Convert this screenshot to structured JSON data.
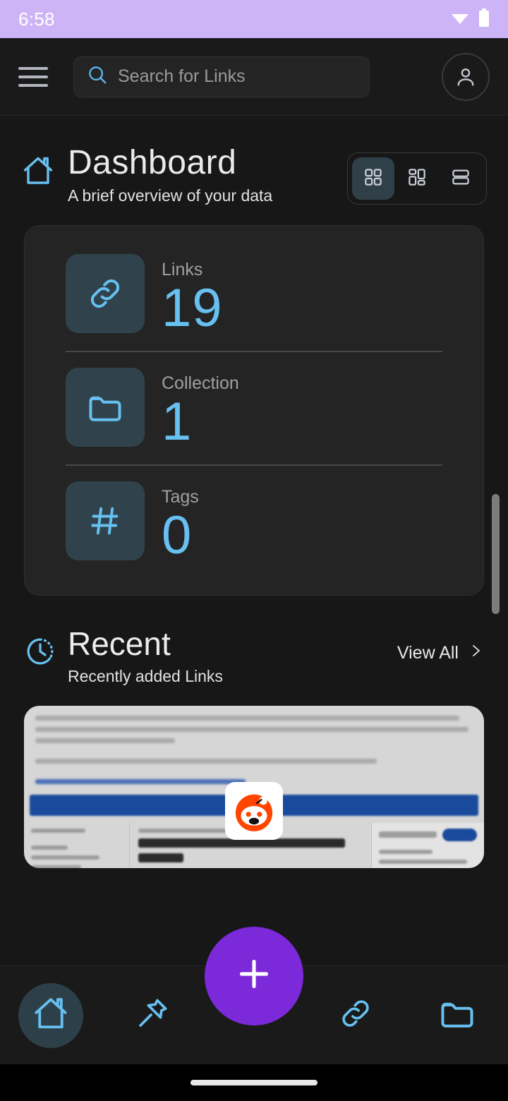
{
  "status_bar": {
    "time": "6:58",
    "icons": [
      "wifi-icon",
      "battery-icon"
    ],
    "background": "#cdb4f7"
  },
  "app_bar": {
    "menu_icon": "hamburger-menu-icon",
    "search": {
      "icon": "search-icon",
      "placeholder": "Search for Links",
      "value": ""
    },
    "profile_icon": "user-avatar-icon"
  },
  "page": {
    "icon": "home-icon",
    "title": "Dashboard",
    "subtitle": "A brief overview of your data",
    "view_modes": [
      {
        "name": "grid-view",
        "icon": "grid-icon",
        "active": true
      },
      {
        "name": "masonry-view",
        "icon": "masonry-icon",
        "active": false
      },
      {
        "name": "list-view",
        "icon": "list-icon",
        "active": false
      }
    ]
  },
  "stats": [
    {
      "icon": "link-icon",
      "label": "Links",
      "value": "19"
    },
    {
      "icon": "folder-icon",
      "label": "Collection",
      "value": "1"
    },
    {
      "icon": "hash-tag-icon",
      "label": "Tags",
      "value": "0"
    }
  ],
  "recent": {
    "icon": "clock-history-icon",
    "title": "Recent",
    "subtitle": "Recently added Links",
    "view_all_label": "View All",
    "view_all_icon": "chevron-right-icon",
    "preview": {
      "favicon": "reddit-icon"
    }
  },
  "bottom_nav": {
    "items": [
      {
        "name": "nav-home",
        "icon": "home-icon",
        "active": true
      },
      {
        "name": "nav-pinned",
        "icon": "pin-icon",
        "active": false
      },
      {
        "name": "nav-add",
        "icon": "plus-icon",
        "active": false,
        "is_fab": true
      },
      {
        "name": "nav-links",
        "icon": "link-icon",
        "active": false
      },
      {
        "name": "nav-collections",
        "icon": "folder-icon",
        "active": false
      }
    ],
    "fab_color": "#7b29d9"
  },
  "colors": {
    "accent_blue": "#67c0f0",
    "icon_tile_bg": "#30434d",
    "card_bg": "#242424",
    "page_bg": "#171717",
    "bar_bg": "#1a1a1a",
    "status_bar": "#cdb4f7",
    "fab_purple": "#7b29d9"
  }
}
